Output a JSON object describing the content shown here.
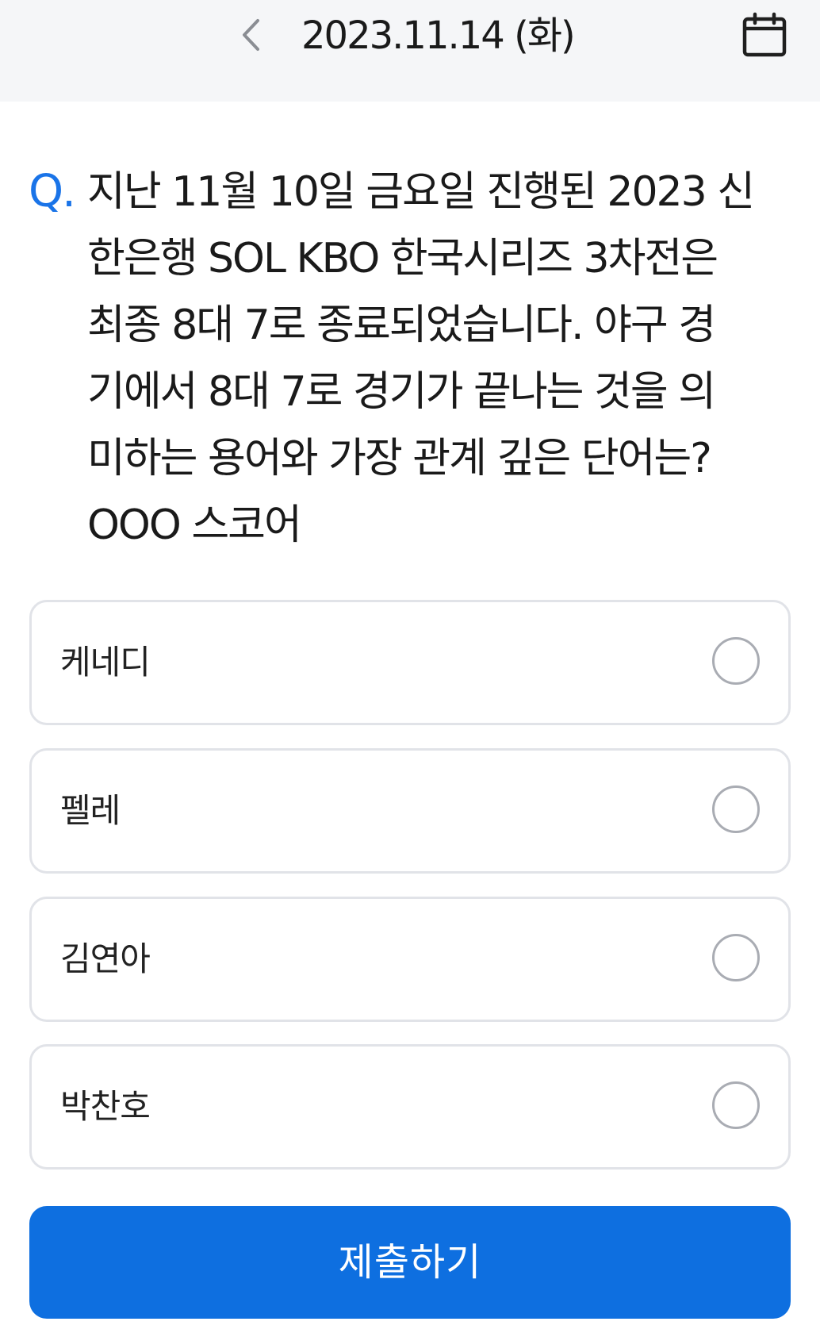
{
  "header": {
    "date": "2023.11.14 (화)",
    "back_icon": "chevron-left-icon",
    "calendar_icon": "calendar-icon"
  },
  "question": {
    "marker": "Q.",
    "lines": [
      "지난 11월 10일 금요일 진행된 2023 신",
      "한은행 SOL KBO 한국시리즈 3차전은",
      "최종 8대 7로 종료되었습니다. 야구 경",
      "기에서 8대 7로 경기가 끝나는 것을 의",
      "미하는 용어와 가장 관계 깊은 단어는?",
      "OOO 스코어"
    ]
  },
  "options": [
    {
      "label": "케네디",
      "selected": false
    },
    {
      "label": "펠레",
      "selected": false
    },
    {
      "label": "김연아",
      "selected": false
    },
    {
      "label": "박찬호",
      "selected": false
    }
  ],
  "submit": {
    "label": "제출하기"
  },
  "colors": {
    "accent": "#0e6fe0",
    "question_marker": "#1a74e8",
    "header_bg": "#f5f6f8",
    "option_border": "#e1e3e8"
  }
}
